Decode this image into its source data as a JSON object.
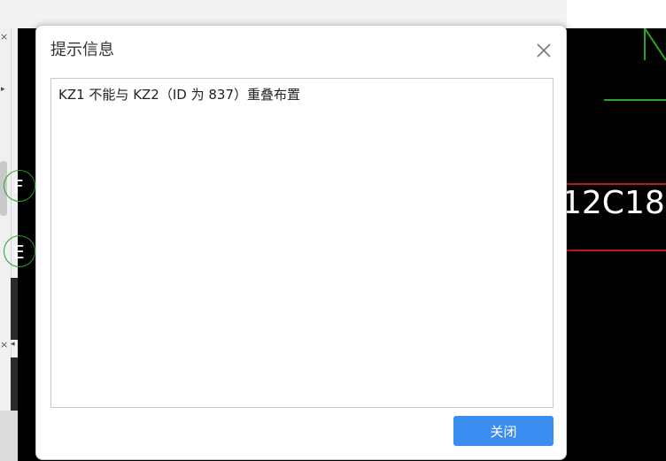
{
  "dialog": {
    "title": "提示信息",
    "message": "KZ1 不能与 KZ2（ID 为 837）重叠布置",
    "close_button_label": "关闭",
    "close_icon": "close-icon",
    "accent_color": "#3c8df0"
  },
  "background": {
    "axis_markers": [
      "F",
      "E"
    ],
    "canvas_text": "12C18",
    "canvas_partial_letter": "N"
  }
}
